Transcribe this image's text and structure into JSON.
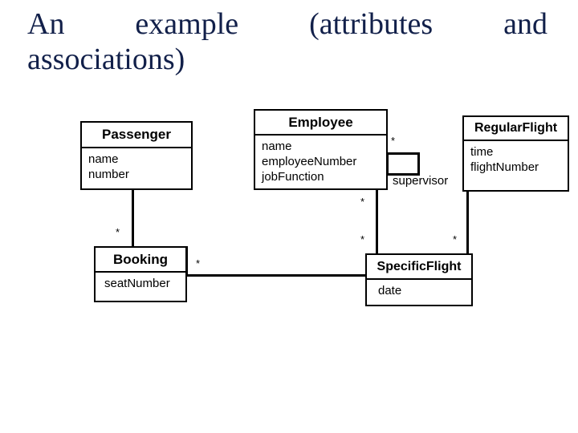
{
  "slide": {
    "title_line_1": "An    example    (attributes    and",
    "title_line_2": "associations)",
    "title_color": "#12204a",
    "background": "#ffffff"
  },
  "diagram": {
    "type": "uml-class-diagram",
    "classes": [
      {
        "id": "passenger",
        "name": "Passenger",
        "attributes": [
          "name",
          "number"
        ]
      },
      {
        "id": "employee",
        "name": "Employee",
        "attributes": [
          "name",
          "employeeNumber",
          "jobFunction"
        ]
      },
      {
        "id": "regularflight",
        "name": "RegularFlight",
        "attributes": [
          "time",
          "flightNumber"
        ]
      },
      {
        "id": "booking",
        "name": "Booking",
        "attributes": [
          "seatNumber"
        ]
      },
      {
        "id": "specificflight",
        "name": "SpecificFlight",
        "attributes": [
          "date"
        ]
      }
    ],
    "associations": [
      {
        "id": "passenger-booking",
        "from": "passenger",
        "to": "booking",
        "multiplicity_to": "*"
      },
      {
        "id": "booking-specificflight",
        "from": "booking",
        "to": "specificflight",
        "multiplicity_from": "*"
      },
      {
        "id": "employee-specificflight",
        "from": "employee",
        "to": "specificflight",
        "multiplicity_from": "*",
        "multiplicity_to": "*"
      },
      {
        "id": "regularflight-specificflight",
        "from": "regularflight",
        "to": "specificflight",
        "multiplicity_to": "*"
      },
      {
        "id": "employee-supervisor",
        "from": "employee",
        "to": "employee",
        "role": "supervisor",
        "multiplicity": "*"
      }
    ],
    "multiplicity_labels": {
      "employee_supervisor_star": "*",
      "employee_down_star": "*",
      "specificflight_left_star": "*",
      "specificflight_right_star": "*",
      "passenger_down_star": "*",
      "booking_right_star": "*"
    },
    "role_labels": {
      "supervisor": "supervisor"
    }
  }
}
